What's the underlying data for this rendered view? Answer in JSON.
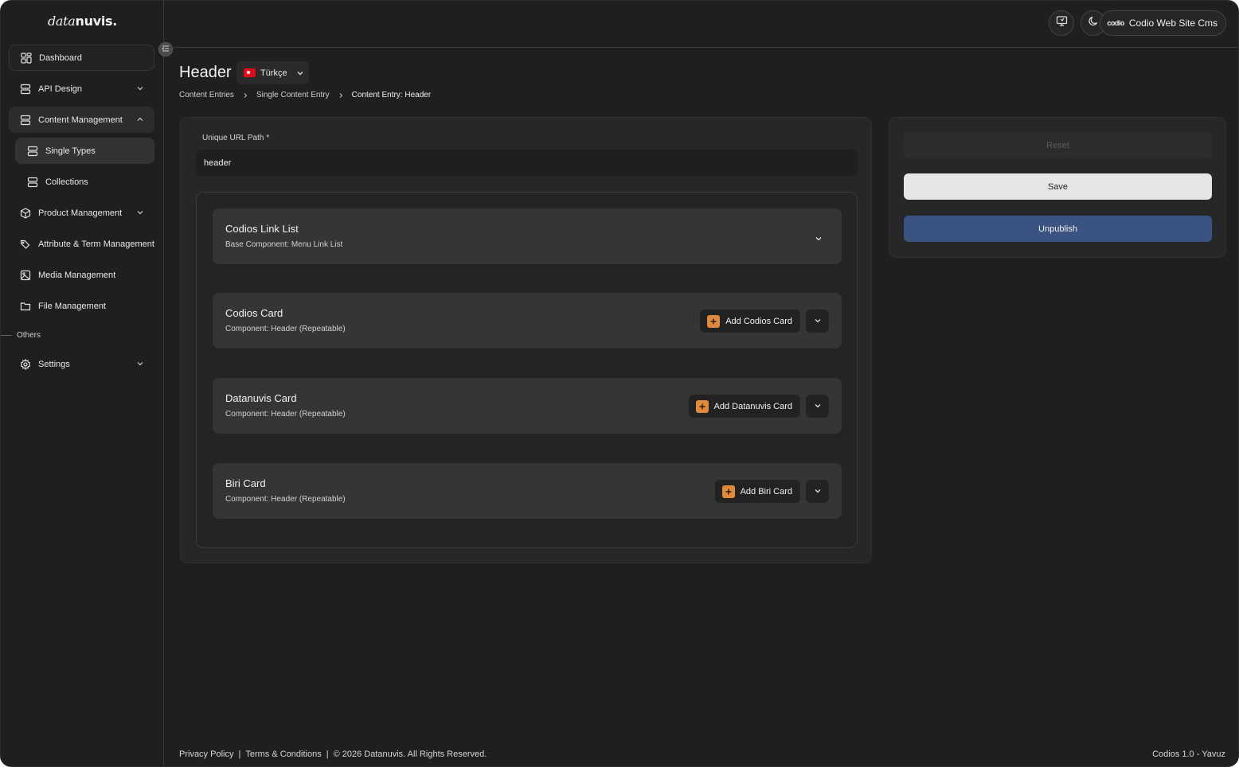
{
  "brand": {
    "logo_light": "data",
    "logo_bold": "nuvis."
  },
  "sidebar": {
    "items": [
      {
        "label": "Dashboard"
      },
      {
        "label": "API Design"
      },
      {
        "label": "Content Management"
      },
      {
        "label": "Single Types"
      },
      {
        "label": "Collections"
      },
      {
        "label": "Product Management"
      },
      {
        "label": "Attribute & Term Management"
      },
      {
        "label": "Media Management"
      },
      {
        "label": "File Management"
      }
    ],
    "section_label": "Others",
    "settings_label": "Settings"
  },
  "topbar": {
    "project_mini_logo": "codio",
    "project_name": "Codio Web Site Cms"
  },
  "page": {
    "title": "Header",
    "language": "Türkçe",
    "breadcrumb": [
      "Content Entries",
      "Single Content Entry",
      "Content Entry: Header"
    ]
  },
  "form": {
    "url_label": "Unique URL Path *",
    "url_value": "header"
  },
  "components": [
    {
      "title": "Codios Link List",
      "subtitle": "Base Component: Menu Link List",
      "add_label": ""
    },
    {
      "title": "Codios Card",
      "subtitle": "Component: Header (Repeatable)",
      "add_label": "Add Codios Card"
    },
    {
      "title": "Datanuvis Card",
      "subtitle": "Component: Header (Repeatable)",
      "add_label": "Add Datanuvis Card"
    },
    {
      "title": "Biri Card",
      "subtitle": "Component: Header (Repeatable)",
      "add_label": "Add Biri Card"
    }
  ],
  "actions": {
    "reset": "Reset",
    "save": "Save",
    "unpublish": "Unpublish"
  },
  "footer": {
    "privacy": "Privacy Policy",
    "terms": "Terms & Conditions",
    "copyright": "© 2026 Datanuvis. All Rights Reserved.",
    "version": "Codios 1.0 - Yavuz"
  },
  "colors": {
    "background": "#1f1f1f",
    "panel": "#272727",
    "card": "#353535",
    "accent_orange": "#e08a3a",
    "unpublish_blue": "#3b5380"
  }
}
